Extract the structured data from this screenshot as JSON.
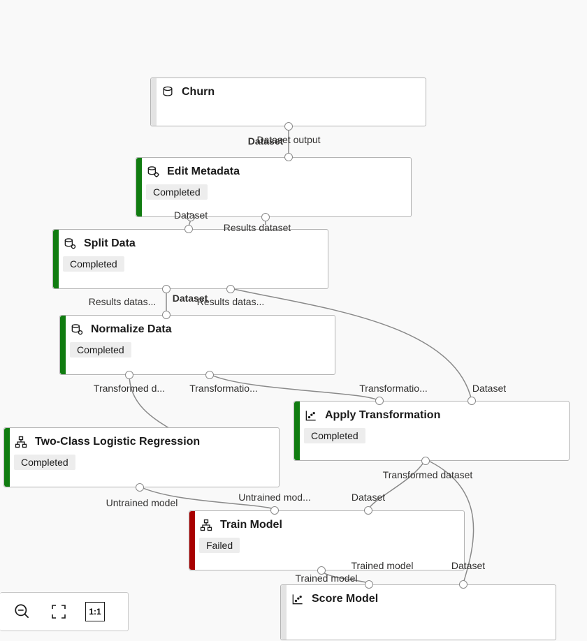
{
  "nodes": {
    "churn": {
      "title": "Churn",
      "status": null,
      "state": "neutral",
      "icon": "db"
    },
    "edit": {
      "title": "Edit Metadata",
      "status": "Completed",
      "state": "success",
      "icon": "db-gear"
    },
    "split": {
      "title": "Split Data",
      "status": "Completed",
      "state": "success",
      "icon": "db-gear"
    },
    "normalize": {
      "title": "Normalize Data",
      "status": "Completed",
      "state": "success",
      "icon": "db-gear"
    },
    "logreg": {
      "title": "Two-Class Logistic Regression",
      "status": "Completed",
      "state": "success",
      "icon": "hier"
    },
    "apply": {
      "title": "Apply Transformation",
      "status": "Completed",
      "state": "success",
      "icon": "scatter"
    },
    "train": {
      "title": "Train Model",
      "status": "Failed",
      "state": "fail",
      "icon": "hier"
    },
    "score": {
      "title": "Score Model",
      "status": null,
      "state": "neutral",
      "icon": "scatter"
    }
  },
  "labels": {
    "dataset_output": "Dataset output",
    "dataset": "Dataset",
    "results_dataset": "Results dataset",
    "results_datas": "Results datas...",
    "transformed_d": "Transformed d...",
    "transformatio": "Transformatio...",
    "transformed_dataset": "Transformed dataset",
    "untrained_model": "Untrained model",
    "untrained_mod": "Untrained mod...",
    "trained_model": "Trained model",
    "failed": "Failed",
    "completed": "Completed"
  },
  "toolbar": {
    "zoom_out": "zoom-out",
    "fit": "fit-to-screen",
    "ratio": "1:1"
  },
  "colors": {
    "success": "#107c10",
    "fail": "#a80000",
    "edge": "#8a8a8a"
  }
}
